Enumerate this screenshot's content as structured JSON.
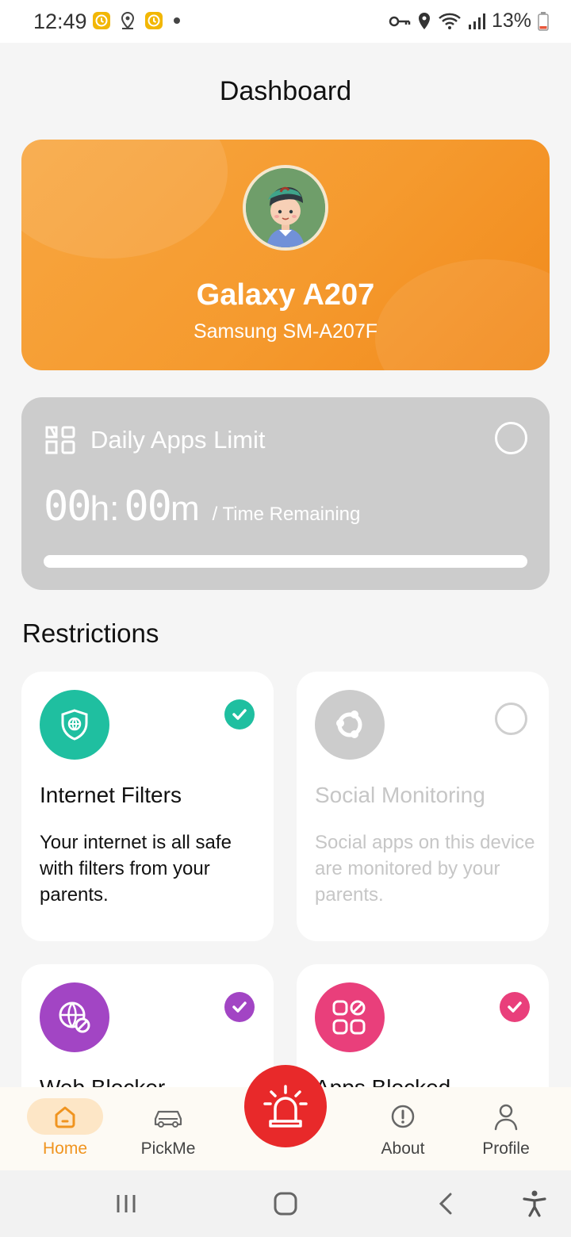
{
  "status_bar": {
    "time": "12:49",
    "battery": "13%",
    "left_icons": [
      "clock-app-icon",
      "location-pin-icon",
      "clock-app-icon",
      "dot-icon"
    ],
    "right_icons": [
      "key-icon",
      "location-icon",
      "wifi-icon",
      "signal-icon",
      "battery-icon"
    ]
  },
  "header": {
    "title": "Dashboard"
  },
  "profile": {
    "device_name": "Galaxy A207",
    "device_model": "Samsung SM-A207F",
    "accent_color": "#f59a2e"
  },
  "daily_limit": {
    "title": "Daily Apps Limit",
    "hours": "00",
    "hours_unit": "h:",
    "minutes": "00",
    "minutes_unit": "m",
    "caption": "/ Time Remaining",
    "enabled": false,
    "progress_percent": 100
  },
  "restrictions": {
    "title": "Restrictions",
    "cards": [
      {
        "title": "Internet Filters",
        "description": "Your internet is all safe with filters from your parents.",
        "enabled": true,
        "color": "#1fbfa0",
        "icon": "shield-globe-icon"
      },
      {
        "title": "Social Monitoring",
        "description": "Social apps on this device are monitored by your parents.",
        "enabled": false,
        "color": "#cccccc",
        "icon": "share-nodes-icon"
      },
      {
        "title": "Web Blocker",
        "description": "",
        "enabled": true,
        "color": "#a245c4",
        "icon": "globe-block-icon"
      },
      {
        "title": "Apps Blocked",
        "description": "",
        "enabled": true,
        "color": "#e93f7b",
        "icon": "apps-grid-icon"
      }
    ]
  },
  "bottom_nav": {
    "items": [
      {
        "label": "Home",
        "active": true
      },
      {
        "label": "PickMe",
        "active": false
      },
      {
        "label": "About",
        "active": false
      },
      {
        "label": "Profile",
        "active": false
      }
    ],
    "sos_color": "#e8292a"
  }
}
